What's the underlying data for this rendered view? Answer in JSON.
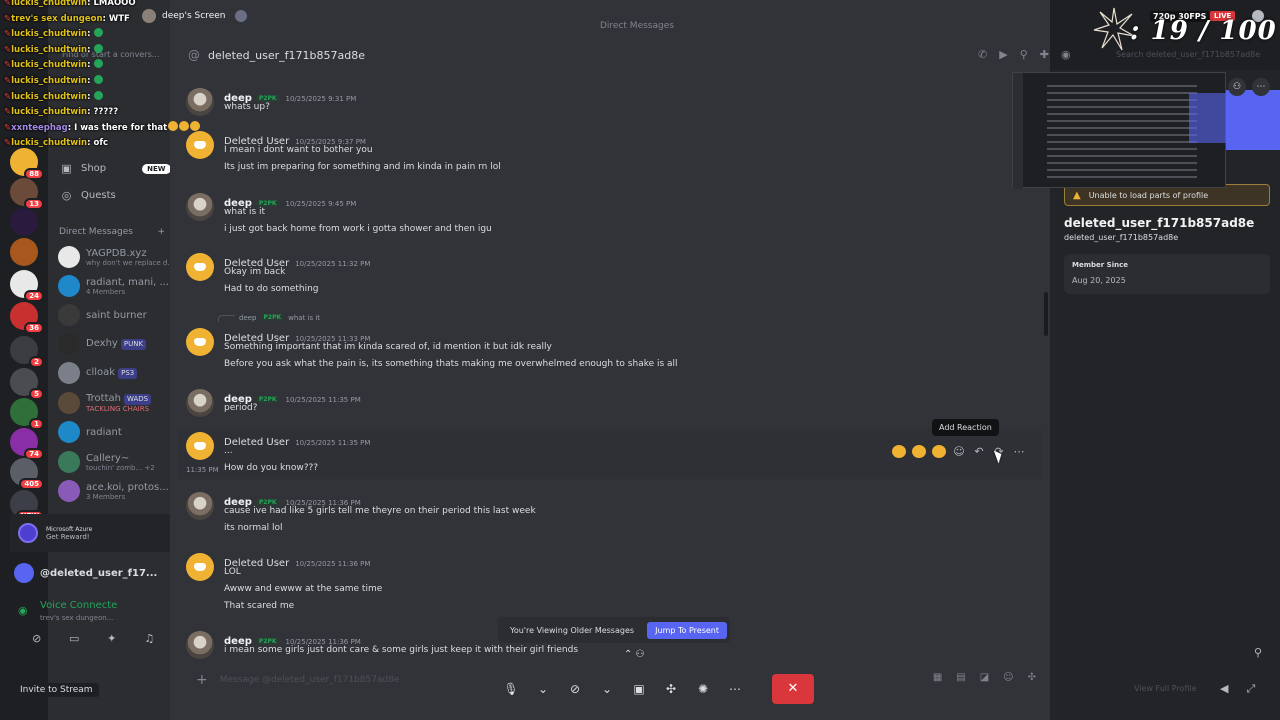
{
  "window": {
    "title": "Direct Messages"
  },
  "stream": {
    "screen_label": "deep's Screen",
    "quality": "720p 30FPS",
    "live": "LIVE",
    "counter": ": 19 / 100"
  },
  "overlay_chat": [
    {
      "user": "luckis_chudtwin",
      "text": " LMAOOO",
      "emojis": 0,
      "green": 0
    },
    {
      "user": "trev's sex dungeon",
      "text": " WTF",
      "emojis": 0,
      "green": 0
    },
    {
      "user": "luckis_chudtwin",
      "text": "",
      "emojis": 0,
      "green": 1
    },
    {
      "user": "luckis_chudtwin",
      "text": "",
      "emojis": 0,
      "green": 1
    },
    {
      "user": "luckis_chudtwin",
      "text": "",
      "emojis": 0,
      "green": 1
    },
    {
      "user": "luckis_chudtwin",
      "text": "",
      "emojis": 0,
      "green": 1
    },
    {
      "user": "luckis_chudtwin",
      "text": "",
      "emojis": 0,
      "green": 1
    },
    {
      "user": "luckis_chudtwin",
      "text": " ?????",
      "emojis": 0,
      "green": 0
    },
    {
      "user": "xxnteephag",
      "text": " I was there for that",
      "emojis": 3,
      "green": 0,
      "alt": true
    },
    {
      "user": "luckis_chudtwin",
      "text": " ofc",
      "emojis": 0,
      "green": 0
    }
  ],
  "sidebar": {
    "search_placeholder": "Find or start a convers...",
    "nav": [
      {
        "label": "Shop",
        "badge": "NEW"
      },
      {
        "label": "Quests"
      }
    ],
    "dm_header": "Direct Messages",
    "add_dm": "+",
    "dms": [
      {
        "name": "YAGPDB.xyz",
        "sub": "why don't we replace d...",
        "tag": ""
      },
      {
        "name": "radiant, mani, ...",
        "sub": "4 Members",
        "tag": ""
      },
      {
        "name": "saint burner",
        "sub": "",
        "tag": ""
      },
      {
        "name": "Dexhy",
        "sub": "",
        "tag": "PUNK"
      },
      {
        "name": "clloak",
        "sub": "",
        "tag": "PS3"
      },
      {
        "name": "Trottah",
        "sub": "TACKLING CHAIRS",
        "tag": "WADS"
      },
      {
        "name": "radiant",
        "sub": "",
        "tag": ""
      },
      {
        "name": "Callery~",
        "sub": "touchin' zomb... +2",
        "tag": ""
      },
      {
        "name": "ace.koi, protos...",
        "sub": "3 Members",
        "tag": ""
      }
    ],
    "promo": {
      "line1": "Microsoft Azure",
      "line2": "Get Reward!"
    },
    "current_dm": "@deleted_user_f17...",
    "voice": {
      "status": "Voice Connecte",
      "channel": "trev's sex dungeon..."
    },
    "invite": "Invite to Stream",
    "rail_badges": [
      "88",
      "13",
      "24",
      "36",
      "2",
      "5",
      "1",
      "74",
      "405",
      "NEW"
    ]
  },
  "chat": {
    "channel": "deleted_user_f171b857ad8e",
    "composer_placeholder": "Message @deleted_user_f171b857ad8e",
    "older_banner": "You're Viewing Older Messages",
    "jump_label": "Jump To Present",
    "add_reaction_tip": "Add Reaction",
    "hover_side_time": "11:35 PM",
    "messages": [
      {
        "author": "deep",
        "badge": "P2PK",
        "time": "10/25/2025 9:31 PM",
        "lines": [
          "whats up?"
        ],
        "kind": "deep"
      },
      {
        "author": "Deleted User",
        "badge": "",
        "time": "10/25/2025 9:37 PM",
        "lines": [
          "I mean i dont want to bother you",
          "Its just im preparing for something and im kinda in pain rn lol"
        ],
        "kind": "del"
      },
      {
        "author": "deep",
        "badge": "P2PK",
        "time": "10/25/2025 9:45 PM",
        "lines": [
          "what is it",
          "i just got back home from work i gotta shower and then igu"
        ],
        "kind": "deep"
      },
      {
        "author": "Deleted User",
        "badge": "",
        "time": "10/25/2025 11:32 PM",
        "lines": [
          "Okay im back",
          "Had to do something"
        ],
        "kind": "del"
      },
      {
        "author": "Deleted User",
        "badge": "",
        "time": "10/25/2025 11:33 PM",
        "lines": [
          "Something important that im kinda scared of, id mention it but idk really",
          "Before you ask what the pain is, its something thats making me overwhelmed enough to shake is all"
        ],
        "kind": "del",
        "reply": {
          "author": "deep",
          "badge": "P2PK",
          "text": "what is it"
        }
      },
      {
        "author": "deep",
        "badge": "P2PK",
        "time": "10/25/2025 11:35 PM",
        "lines": [
          "period?"
        ],
        "kind": "deep"
      },
      {
        "author": "Deleted User",
        "badge": "",
        "time": "10/25/2025 11:35 PM",
        "lines": [
          "...",
          "How do you know???"
        ],
        "kind": "del"
      },
      {
        "author": "deep",
        "badge": "P2PK",
        "time": "10/25/2025 11:36 PM",
        "lines": [
          "cause ive had like 5 girls tell me theyre on their period this last week",
          "its normal lol"
        ],
        "kind": "deep"
      },
      {
        "author": "Deleted User",
        "badge": "",
        "time": "10/25/2025 11:36 PM",
        "lines": [
          "LOL",
          "Awww and ewww at the same time",
          "That scared me"
        ],
        "kind": "del"
      },
      {
        "author": "deep",
        "badge": "P2PK",
        "time": "10/25/2025 11:36 PM",
        "lines": [
          "i mean some girls just dont care & some girls just keep it with their girl friends"
        ],
        "kind": "deep"
      }
    ]
  },
  "profile": {
    "warning": "Unable to load parts of profile",
    "username": "deleted_user_f171b857ad8e",
    "handle": "deleted_user_f171b857ad8e",
    "member_since_label": "Member Since",
    "member_since": "Aug 20, 2025",
    "view_full": "View Full Profile",
    "search_placeholder": "Search deleted_user_f171b857ad8e"
  },
  "colors": {
    "blurple": "#5865f2",
    "danger": "#da373c",
    "online": "#23a55a",
    "warning": "#f0b232"
  }
}
